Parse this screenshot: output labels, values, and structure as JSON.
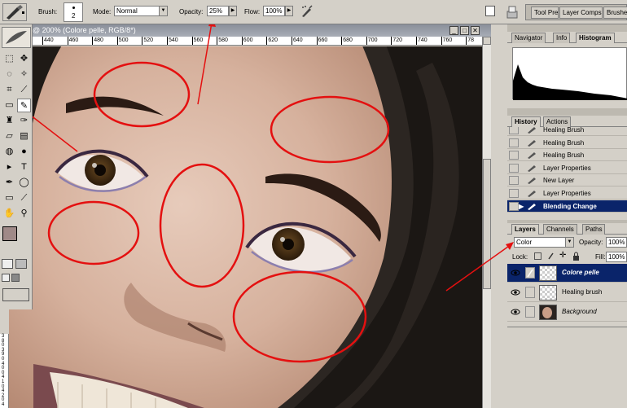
{
  "options_bar": {
    "brush_label": "Brush:",
    "brush_size": "2",
    "mode_label": "Mode:",
    "mode_value": "Normal",
    "opacity_label": "Opacity:",
    "opacity_value": "25%",
    "flow_label": "Flow:",
    "flow_value": "100%"
  },
  "palette_well": {
    "tabs": [
      "Tool Pre",
      "Layer Comps",
      "Brushes"
    ]
  },
  "document": {
    "title": "@ 200% (Colore pelle, RGB/8*)",
    "ruler_ticks": [
      "440",
      "460",
      "480",
      "500",
      "520",
      "540",
      "560",
      "580",
      "600",
      "620",
      "640",
      "660",
      "680",
      "700",
      "720",
      "740",
      "760",
      "78"
    ],
    "vruler_ticks": [
      "3",
      "8",
      "0",
      "3",
      "9",
      "0",
      "4",
      "0",
      "0",
      "4",
      "1",
      "0",
      "4",
      "2",
      "0",
      "4"
    ]
  },
  "navigator_panel": {
    "tabs": [
      "Navigator",
      "Info",
      "Histogram"
    ],
    "active_tab": "Histogram"
  },
  "history_panel": {
    "tabs": [
      "History",
      "Actions"
    ],
    "items": [
      "Healing Brush",
      "Healing Brush",
      "Healing Brush",
      "Layer Properties",
      "New Layer",
      "Layer Properties",
      "Blending Change"
    ],
    "selected_index": 6
  },
  "layers_panel": {
    "tabs": [
      "Layers",
      "Channels",
      "Paths"
    ],
    "blend_mode": "Color",
    "opacity_label": "Opacity:",
    "opacity_value": "100%",
    "lock_label": "Lock:",
    "fill_label": "Fill:",
    "fill_value": "100%",
    "layers": [
      {
        "name": "Colore pelle",
        "selected": true
      },
      {
        "name": "Healing brush",
        "selected": false
      },
      {
        "name": "Background",
        "selected": false
      }
    ]
  },
  "colors": {
    "selection": "#0a246a",
    "annotation": "#e41010",
    "foreground_swatch": "#a08a88",
    "background_swatch": "#ffffff"
  }
}
